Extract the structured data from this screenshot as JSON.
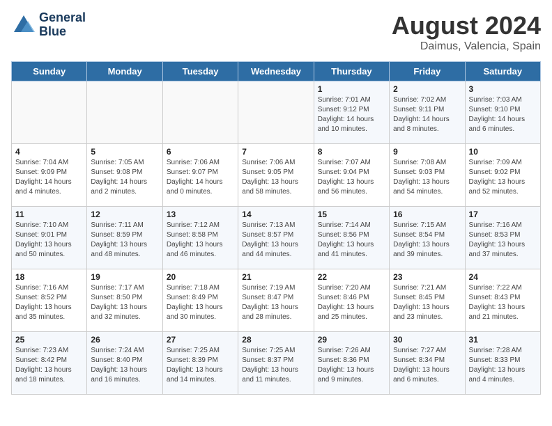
{
  "header": {
    "logo_line1": "General",
    "logo_line2": "Blue",
    "month_title": "August 2024",
    "subtitle": "Daimus, Valencia, Spain"
  },
  "weekdays": [
    "Sunday",
    "Monday",
    "Tuesday",
    "Wednesday",
    "Thursday",
    "Friday",
    "Saturday"
  ],
  "weeks": [
    [
      {
        "day": "",
        "sunrise": "",
        "sunset": "",
        "daylight": ""
      },
      {
        "day": "",
        "sunrise": "",
        "sunset": "",
        "daylight": ""
      },
      {
        "day": "",
        "sunrise": "",
        "sunset": "",
        "daylight": ""
      },
      {
        "day": "",
        "sunrise": "",
        "sunset": "",
        "daylight": ""
      },
      {
        "day": "1",
        "sunrise": "Sunrise: 7:01 AM",
        "sunset": "Sunset: 9:12 PM",
        "daylight": "Daylight: 14 hours and 10 minutes."
      },
      {
        "day": "2",
        "sunrise": "Sunrise: 7:02 AM",
        "sunset": "Sunset: 9:11 PM",
        "daylight": "Daylight: 14 hours and 8 minutes."
      },
      {
        "day": "3",
        "sunrise": "Sunrise: 7:03 AM",
        "sunset": "Sunset: 9:10 PM",
        "daylight": "Daylight: 14 hours and 6 minutes."
      }
    ],
    [
      {
        "day": "4",
        "sunrise": "Sunrise: 7:04 AM",
        "sunset": "Sunset: 9:09 PM",
        "daylight": "Daylight: 14 hours and 4 minutes."
      },
      {
        "day": "5",
        "sunrise": "Sunrise: 7:05 AM",
        "sunset": "Sunset: 9:08 PM",
        "daylight": "Daylight: 14 hours and 2 minutes."
      },
      {
        "day": "6",
        "sunrise": "Sunrise: 7:06 AM",
        "sunset": "Sunset: 9:07 PM",
        "daylight": "Daylight: 14 hours and 0 minutes."
      },
      {
        "day": "7",
        "sunrise": "Sunrise: 7:06 AM",
        "sunset": "Sunset: 9:05 PM",
        "daylight": "Daylight: 13 hours and 58 minutes."
      },
      {
        "day": "8",
        "sunrise": "Sunrise: 7:07 AM",
        "sunset": "Sunset: 9:04 PM",
        "daylight": "Daylight: 13 hours and 56 minutes."
      },
      {
        "day": "9",
        "sunrise": "Sunrise: 7:08 AM",
        "sunset": "Sunset: 9:03 PM",
        "daylight": "Daylight: 13 hours and 54 minutes."
      },
      {
        "day": "10",
        "sunrise": "Sunrise: 7:09 AM",
        "sunset": "Sunset: 9:02 PM",
        "daylight": "Daylight: 13 hours and 52 minutes."
      }
    ],
    [
      {
        "day": "11",
        "sunrise": "Sunrise: 7:10 AM",
        "sunset": "Sunset: 9:01 PM",
        "daylight": "Daylight: 13 hours and 50 minutes."
      },
      {
        "day": "12",
        "sunrise": "Sunrise: 7:11 AM",
        "sunset": "Sunset: 8:59 PM",
        "daylight": "Daylight: 13 hours and 48 minutes."
      },
      {
        "day": "13",
        "sunrise": "Sunrise: 7:12 AM",
        "sunset": "Sunset: 8:58 PM",
        "daylight": "Daylight: 13 hours and 46 minutes."
      },
      {
        "day": "14",
        "sunrise": "Sunrise: 7:13 AM",
        "sunset": "Sunset: 8:57 PM",
        "daylight": "Daylight: 13 hours and 44 minutes."
      },
      {
        "day": "15",
        "sunrise": "Sunrise: 7:14 AM",
        "sunset": "Sunset: 8:56 PM",
        "daylight": "Daylight: 13 hours and 41 minutes."
      },
      {
        "day": "16",
        "sunrise": "Sunrise: 7:15 AM",
        "sunset": "Sunset: 8:54 PM",
        "daylight": "Daylight: 13 hours and 39 minutes."
      },
      {
        "day": "17",
        "sunrise": "Sunrise: 7:16 AM",
        "sunset": "Sunset: 8:53 PM",
        "daylight": "Daylight: 13 hours and 37 minutes."
      }
    ],
    [
      {
        "day": "18",
        "sunrise": "Sunrise: 7:16 AM",
        "sunset": "Sunset: 8:52 PM",
        "daylight": "Daylight: 13 hours and 35 minutes."
      },
      {
        "day": "19",
        "sunrise": "Sunrise: 7:17 AM",
        "sunset": "Sunset: 8:50 PM",
        "daylight": "Daylight: 13 hours and 32 minutes."
      },
      {
        "day": "20",
        "sunrise": "Sunrise: 7:18 AM",
        "sunset": "Sunset: 8:49 PM",
        "daylight": "Daylight: 13 hours and 30 minutes."
      },
      {
        "day": "21",
        "sunrise": "Sunrise: 7:19 AM",
        "sunset": "Sunset: 8:47 PM",
        "daylight": "Daylight: 13 hours and 28 minutes."
      },
      {
        "day": "22",
        "sunrise": "Sunrise: 7:20 AM",
        "sunset": "Sunset: 8:46 PM",
        "daylight": "Daylight: 13 hours and 25 minutes."
      },
      {
        "day": "23",
        "sunrise": "Sunrise: 7:21 AM",
        "sunset": "Sunset: 8:45 PM",
        "daylight": "Daylight: 13 hours and 23 minutes."
      },
      {
        "day": "24",
        "sunrise": "Sunrise: 7:22 AM",
        "sunset": "Sunset: 8:43 PM",
        "daylight": "Daylight: 13 hours and 21 minutes."
      }
    ],
    [
      {
        "day": "25",
        "sunrise": "Sunrise: 7:23 AM",
        "sunset": "Sunset: 8:42 PM",
        "daylight": "Daylight: 13 hours and 18 minutes."
      },
      {
        "day": "26",
        "sunrise": "Sunrise: 7:24 AM",
        "sunset": "Sunset: 8:40 PM",
        "daylight": "Daylight: 13 hours and 16 minutes."
      },
      {
        "day": "27",
        "sunrise": "Sunrise: 7:25 AM",
        "sunset": "Sunset: 8:39 PM",
        "daylight": "Daylight: 13 hours and 14 minutes."
      },
      {
        "day": "28",
        "sunrise": "Sunrise: 7:25 AM",
        "sunset": "Sunset: 8:37 PM",
        "daylight": "Daylight: 13 hours and 11 minutes."
      },
      {
        "day": "29",
        "sunrise": "Sunrise: 7:26 AM",
        "sunset": "Sunset: 8:36 PM",
        "daylight": "Daylight: 13 hours and 9 minutes."
      },
      {
        "day": "30",
        "sunrise": "Sunrise: 7:27 AM",
        "sunset": "Sunset: 8:34 PM",
        "daylight": "Daylight: 13 hours and 6 minutes."
      },
      {
        "day": "31",
        "sunrise": "Sunrise: 7:28 AM",
        "sunset": "Sunset: 8:33 PM",
        "daylight": "Daylight: 13 hours and 4 minutes."
      }
    ]
  ]
}
